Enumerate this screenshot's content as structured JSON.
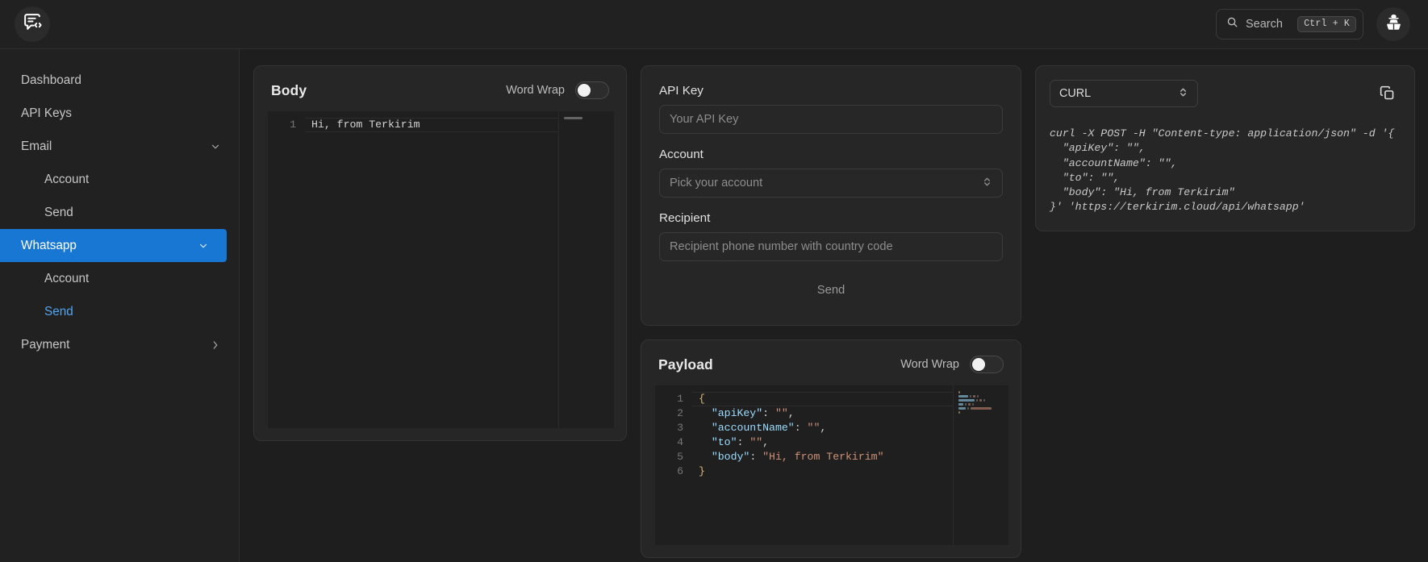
{
  "app": {
    "logo_icon": "chat-code-bubble-icon"
  },
  "topbar": {
    "search": {
      "label": "Search",
      "shortcut": "Ctrl + K",
      "icon": "search-icon"
    },
    "avatar_icon": "incognito-detective-icon"
  },
  "sidebar": {
    "items": [
      {
        "label": "Dashboard",
        "level": 0,
        "state": "normal",
        "chevron": ""
      },
      {
        "label": "API Keys",
        "level": 0,
        "state": "normal",
        "chevron": ""
      },
      {
        "label": "Email",
        "level": 0,
        "state": "normal",
        "chevron": "down"
      },
      {
        "label": "Account",
        "level": 1,
        "state": "normal",
        "chevron": ""
      },
      {
        "label": "Send",
        "level": 1,
        "state": "normal",
        "chevron": ""
      },
      {
        "label": "Whatsapp",
        "level": 0,
        "state": "active",
        "chevron": "down"
      },
      {
        "label": "Account",
        "level": 1,
        "state": "normal",
        "chevron": ""
      },
      {
        "label": "Send",
        "level": 1,
        "state": "sub-active",
        "chevron": ""
      },
      {
        "label": "Payment",
        "level": 0,
        "state": "normal",
        "chevron": "right"
      }
    ]
  },
  "body_panel": {
    "title": "Body",
    "word_wrap_label": "Word Wrap",
    "word_wrap_on": false,
    "lines": [
      {
        "no": "1",
        "tokens": [
          {
            "t": "Hi, from Terkirim",
            "c": "t-plain"
          }
        ]
      }
    ]
  },
  "form": {
    "api_key": {
      "label": "API Key",
      "placeholder": "Your API Key",
      "value": ""
    },
    "account": {
      "label": "Account",
      "placeholder": "Pick your account",
      "value": ""
    },
    "recipient": {
      "label": "Recipient",
      "placeholder": "Recipient phone number with country code",
      "value": ""
    },
    "send_label": "Send"
  },
  "payload_panel": {
    "title": "Payload",
    "word_wrap_label": "Word Wrap",
    "word_wrap_on": false,
    "lines": [
      {
        "no": "1",
        "tokens": [
          {
            "t": "{",
            "c": "t-brace"
          }
        ]
      },
      {
        "no": "2",
        "tokens": [
          {
            "t": "  ",
            "c": "t-plain"
          },
          {
            "t": "\"apiKey\"",
            "c": "t-key"
          },
          {
            "t": ": ",
            "c": "t-punc"
          },
          {
            "t": "\"\"",
            "c": "t-str"
          },
          {
            "t": ",",
            "c": "t-punc"
          }
        ]
      },
      {
        "no": "3",
        "tokens": [
          {
            "t": "  ",
            "c": "t-plain"
          },
          {
            "t": "\"accountName\"",
            "c": "t-key"
          },
          {
            "t": ": ",
            "c": "t-punc"
          },
          {
            "t": "\"\"",
            "c": "t-str"
          },
          {
            "t": ",",
            "c": "t-punc"
          }
        ]
      },
      {
        "no": "4",
        "tokens": [
          {
            "t": "  ",
            "c": "t-plain"
          },
          {
            "t": "\"to\"",
            "c": "t-key"
          },
          {
            "t": ": ",
            "c": "t-punc"
          },
          {
            "t": "\"\"",
            "c": "t-str"
          },
          {
            "t": ",",
            "c": "t-punc"
          }
        ]
      },
      {
        "no": "5",
        "tokens": [
          {
            "t": "  ",
            "c": "t-plain"
          },
          {
            "t": "\"body\"",
            "c": "t-key"
          },
          {
            "t": ": ",
            "c": "t-punc"
          },
          {
            "t": "\"Hi, from Terkirim\"",
            "c": "t-str"
          }
        ]
      },
      {
        "no": "6",
        "tokens": [
          {
            "t": "}",
            "c": "t-brace"
          }
        ]
      }
    ]
  },
  "curl_panel": {
    "language_selected": "CURL",
    "copy_icon": "copy-icon",
    "code": "curl -X POST -H \"Content-type: application/json\" -d '{\n  \"apiKey\": \"\",\n  \"accountName\": \"\",\n  \"to\": \"\",\n  \"body\": \"Hi, from Terkirim\"\n}' 'https://terkirim.cloud/api/whatsapp'"
  },
  "colors": {
    "accent": "#1877d2",
    "sub_active": "#53a4ef",
    "panel_bg": "#262626",
    "editor_bg": "#1f1f1f"
  }
}
